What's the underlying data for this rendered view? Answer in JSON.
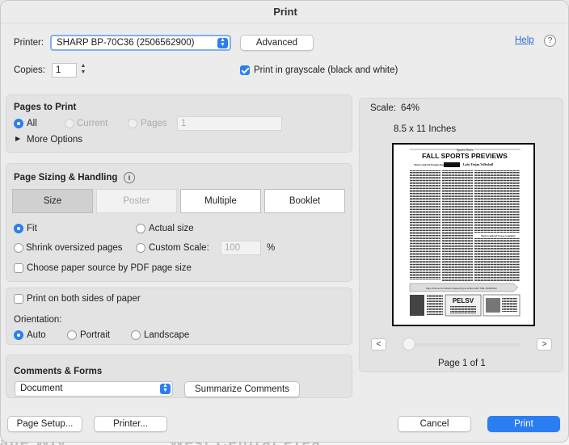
{
  "window": {
    "title": "Print"
  },
  "printer": {
    "label": "Printer:",
    "selected": "SHARP BP-70C36 (2506562900)",
    "advanced_label": "Advanced",
    "help_label": "Help",
    "help_icon": "?"
  },
  "copies": {
    "label": "Copies:",
    "value": "1"
  },
  "grayscale": {
    "label": "Print in grayscale (black and white)",
    "checked": true
  },
  "pages_to_print": {
    "title": "Pages to Print",
    "all_label": "All",
    "current_label": "Current",
    "pages_label": "Pages",
    "pages_value": "1",
    "more_options_label": "More Options"
  },
  "sizing": {
    "title": "Page Sizing & Handling",
    "info_icon": "i",
    "tabs": [
      "Size",
      "Poster",
      "Multiple",
      "Booklet"
    ],
    "fit_label": "Fit",
    "actual_label": "Actual size",
    "shrink_label": "Shrink oversized pages",
    "custom_label": "Custom Scale:",
    "custom_value": "100",
    "percent": "%",
    "paper_source_label": "Choose paper source by PDF page size"
  },
  "duplex": {
    "label": "Print on both sides of paper",
    "orientation_label": "Orientation:",
    "auto_label": "Auto",
    "portrait_label": "Portrait",
    "landscape_label": "Landscape"
  },
  "comments": {
    "title": "Comments & Forms",
    "selected": "Document",
    "summarize_label": "Summarize Comments"
  },
  "preview": {
    "scale_label": "Scale:",
    "scale_value": "64%",
    "paper_size": "8.5 x 11 Inches",
    "prev_label": "<",
    "next_label": ">",
    "page_info": "Page 1 of 1",
    "doc_header": "Sports News",
    "doc_headline": "FALL SPORTS PREVIEWS",
    "doc_sub1": "West Central Trojan Football",
    "doc_sub2": "Lady Trojan Volleyball",
    "doc_sub3": "West Central Cross-Country",
    "doc_banner": "Stay informed on what's happening at school with THE JOURNAL!",
    "doc_ad": "PELSV"
  },
  "footer": {
    "page_setup_label": "Page Setup...",
    "printer_label": "Printer...",
    "cancel_label": "Cancel",
    "print_label": "Print"
  },
  "colors": {
    "accent": "#2a7ef0",
    "panel": "#e3e3e3"
  }
}
